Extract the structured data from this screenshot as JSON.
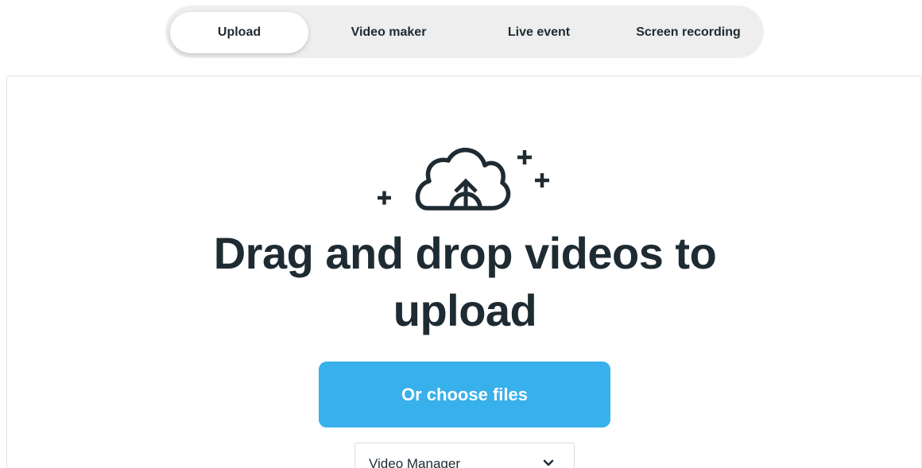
{
  "tabs": [
    {
      "label": "Upload",
      "active": true
    },
    {
      "label": "Video maker",
      "active": false
    },
    {
      "label": "Live event",
      "active": false
    },
    {
      "label": "Screen recording",
      "active": false
    }
  ],
  "upload": {
    "headline": "Drag and drop videos to upload",
    "choose_button_label": "Or choose files",
    "destination_selected": "Video Manager",
    "illustration_icon": "cloud-upload-icon"
  },
  "colors": {
    "accent": "#38b0ec",
    "text": "#1f2b33",
    "tabbar_bg": "#eeeeee"
  }
}
